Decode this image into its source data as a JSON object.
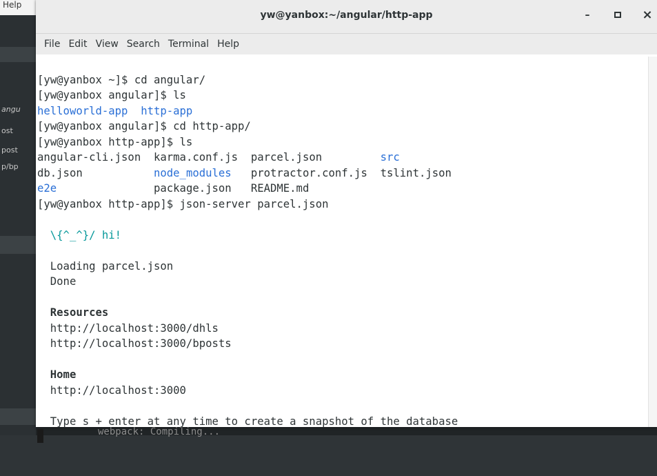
{
  "background": {
    "help_fragment": "Help",
    "side_labels": [
      "angu",
      "ost",
      "post",
      "p/bp"
    ],
    "bottom_text": "webpack: Compiling..."
  },
  "window": {
    "title": "yw@yanbox:~/angular/http-app",
    "minimize_glyph": "–",
    "maximize_glyph": "▫",
    "close_glyph": "×"
  },
  "menu": [
    "File",
    "Edit",
    "View",
    "Search",
    "Terminal",
    "Help"
  ],
  "terminal": {
    "l1": "[yw@yanbox ~]$ cd angular/",
    "l2": "[yw@yanbox angular]$ ls",
    "l3a": "helloworld-app",
    "l3b": "http-app",
    "l4": "[yw@yanbox angular]$ cd http-app/",
    "l5": "[yw@yanbox http-app]$ ls",
    "ls_row1": [
      "angular-cli.json",
      "karma.conf.js",
      "parcel.json",
      "src"
    ],
    "ls_row2": [
      "db.json",
      "node_modules",
      "protractor.conf.js",
      "tslint.json"
    ],
    "ls_row3": [
      "e2e",
      "package.json",
      "README.md"
    ],
    "l9": "[yw@yanbox http-app]$ json-server parcel.json",
    "hi": "\\{^_^}/ hi!",
    "loading": "Loading parcel.json",
    "done": "Done",
    "resources_heading": "Resources",
    "res1": "http://localhost:3000/dhls",
    "res2": "http://localhost:3000/bposts",
    "home_heading": "Home",
    "home_url": "http://localhost:3000",
    "snapshot_hint": "Type s + enter at any time to create a snapshot of the database"
  },
  "colors": {
    "directory": "#2a6fd6",
    "banner": "#06989a"
  }
}
